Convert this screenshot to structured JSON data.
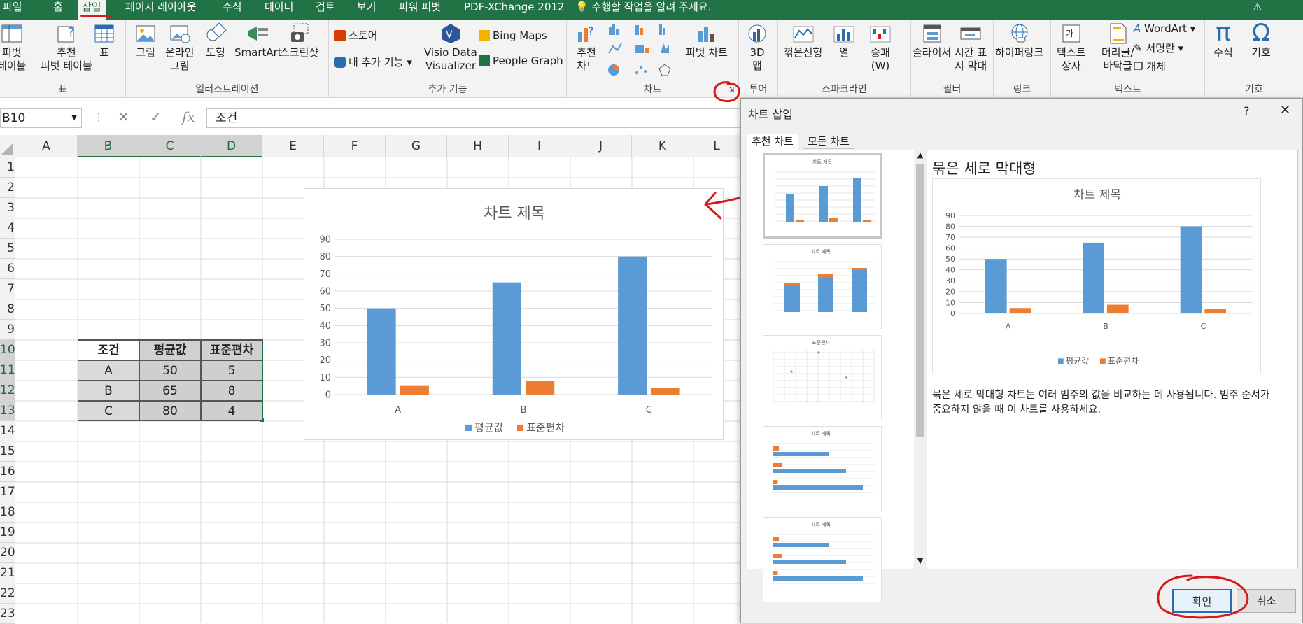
{
  "ribbon_tabs": [
    "파일",
    "홈",
    "삽입",
    "페이지 레이아웃",
    "수식",
    "데이터",
    "검토",
    "보기",
    "파워 피벗",
    "PDF-XChange 2012"
  ],
  "active_tab": "삽입",
  "tell_me": "수행할 작업을 알려 주세요.",
  "groups": {
    "table": {
      "label": "표",
      "items": [
        "피벗\n테이블",
        "추천\n피벗 테이블",
        "표"
      ]
    },
    "illustrations": {
      "label": "일러스트레이션",
      "items": [
        "그림",
        "온라인\n그림",
        "도형",
        "SmartArt",
        "스크린샷"
      ]
    },
    "addins": {
      "label": "추가 기능",
      "store": "스토어",
      "my_addins": "내 추가 기능",
      "visio": "Visio Data\nVisualizer",
      "bing": "Bing Maps",
      "people": "People Graph"
    },
    "charts": {
      "label": "차트",
      "recommended": "추천\n차트",
      "pivot_chart": "피벗 차트"
    },
    "tours": {
      "label": "투어",
      "map3d": "3D\n맵"
    },
    "sparklines": {
      "label": "스파크라인",
      "items": [
        "꺾은선형",
        "열",
        "승패\n(W)"
      ]
    },
    "filters": {
      "label": "필터",
      "items": [
        "슬라이서",
        "시간 표\n시 막대"
      ]
    },
    "links": {
      "label": "링크",
      "items": [
        "하이퍼링크"
      ]
    },
    "text": {
      "label": "텍스트",
      "items": [
        "텍스트\n상자",
        "머리글/\n바닥글"
      ],
      "wordart": "WordArt",
      "signature": "서명란",
      "object": "개체"
    },
    "symbols": {
      "label": "기호",
      "items": [
        "수식",
        "기호"
      ]
    }
  },
  "formula_bar": {
    "name_box": "B10",
    "formula": "조건"
  },
  "columns": [
    "A",
    "B",
    "C",
    "D",
    "E",
    "F",
    "G",
    "H",
    "I",
    "J",
    "K",
    "L"
  ],
  "rows": [
    "1",
    "2",
    "3",
    "4",
    "5",
    "6",
    "7",
    "8",
    "9",
    "10",
    "11",
    "12",
    "13",
    "14",
    "15",
    "16",
    "17",
    "18",
    "19",
    "20",
    "21",
    "22",
    "23"
  ],
  "table": {
    "headers": [
      "조건",
      "평균값",
      "표준편차"
    ],
    "rows": [
      [
        "A",
        "50",
        "5"
      ],
      [
        "B",
        "65",
        "8"
      ],
      [
        "C",
        "80",
        "4"
      ]
    ]
  },
  "chart_data": {
    "type": "bar",
    "title": "차트 제목",
    "categories": [
      "A",
      "B",
      "C"
    ],
    "series": [
      {
        "name": "평균값",
        "values": [
          50,
          65,
          80
        ],
        "color": "#5b9bd5"
      },
      {
        "name": "표준편차",
        "values": [
          5,
          8,
          4
        ],
        "color": "#ed7d31"
      }
    ],
    "ylim": [
      0,
      90
    ],
    "yticks": [
      0,
      10,
      20,
      30,
      40,
      50,
      60,
      70,
      80,
      90
    ],
    "legend": "bottom",
    "grid": true
  },
  "dialog": {
    "title": "차트 삽입",
    "help": "?",
    "close": "✕",
    "tabs": [
      "추천 차트",
      "모든 차트"
    ],
    "preview_heading": "묶은 세로 막대형",
    "description": "묶은 세로 막대형 차트는 여러 범주의 값을 비교하는 데 사용됩니다. 범주 순서가 중요하지 않을 때 이 차트를 사용하세요.",
    "thumb_titles": [
      "차트 제목",
      "차트 제목",
      "표준편차",
      "차트 제목",
      "차트 제목"
    ],
    "ok": "확인",
    "cancel": "취소"
  }
}
